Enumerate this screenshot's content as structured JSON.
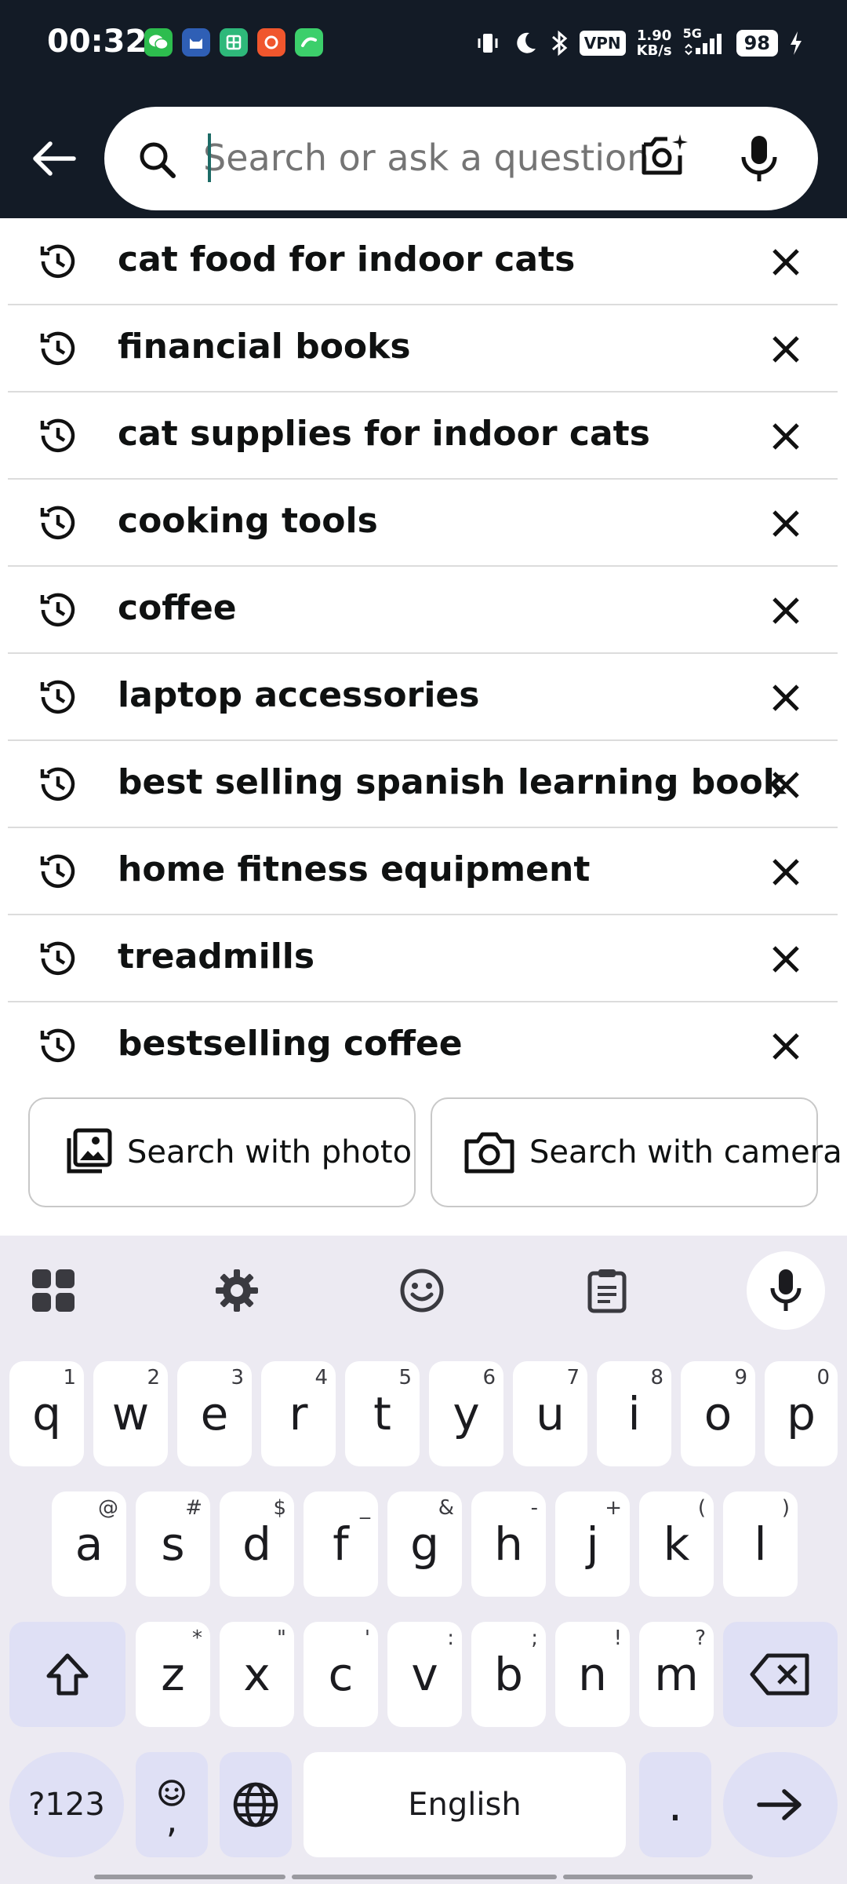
{
  "status_bar": {
    "time": "00:32",
    "vpn": "VPN",
    "speed_value": "1.90",
    "speed_unit": "KB/s",
    "network": "5G",
    "battery": "98"
  },
  "search": {
    "placeholder": "Search or ask a question"
  },
  "history": [
    {
      "label": "cat food for indoor cats"
    },
    {
      "label": "financial books"
    },
    {
      "label": "cat supplies for indoor cats"
    },
    {
      "label": "cooking tools"
    },
    {
      "label": "coffee"
    },
    {
      "label": "laptop accessories"
    },
    {
      "label": "best selling spanish learning book"
    },
    {
      "label": "home fitness equipment"
    },
    {
      "label": "treadmills"
    },
    {
      "label": "bestselling coffee"
    }
  ],
  "buttons": {
    "photo": "Search with photo",
    "camera": "Search with camera"
  },
  "keyboard": {
    "row1": [
      {
        "k": "q",
        "s": "1"
      },
      {
        "k": "w",
        "s": "2"
      },
      {
        "k": "e",
        "s": "3"
      },
      {
        "k": "r",
        "s": "4"
      },
      {
        "k": "t",
        "s": "5"
      },
      {
        "k": "y",
        "s": "6"
      },
      {
        "k": "u",
        "s": "7"
      },
      {
        "k": "i",
        "s": "8"
      },
      {
        "k": "o",
        "s": "9"
      },
      {
        "k": "p",
        "s": "0"
      }
    ],
    "row2": [
      {
        "k": "a",
        "s": "@"
      },
      {
        "k": "s",
        "s": "#"
      },
      {
        "k": "d",
        "s": "$"
      },
      {
        "k": "f",
        "s": "_"
      },
      {
        "k": "g",
        "s": "&"
      },
      {
        "k": "h",
        "s": "-"
      },
      {
        "k": "j",
        "s": "+"
      },
      {
        "k": "k",
        "s": "("
      },
      {
        "k": "l",
        "s": ")"
      }
    ],
    "row3": [
      {
        "k": "z",
        "s": "*"
      },
      {
        "k": "x",
        "s": "\""
      },
      {
        "k": "c",
        "s": "'"
      },
      {
        "k": "v",
        "s": ":"
      },
      {
        "k": "b",
        "s": ";"
      },
      {
        "k": "n",
        "s": "!"
      },
      {
        "k": "m",
        "s": "?"
      }
    ],
    "symbols_label": "?123",
    "comma": ",",
    "space_label": "English",
    "period": "."
  },
  "colors": {
    "header_bg": "#131b26",
    "keyboard_bg": "#eceaf2",
    "function_key_bg": "#dfe0f5"
  }
}
